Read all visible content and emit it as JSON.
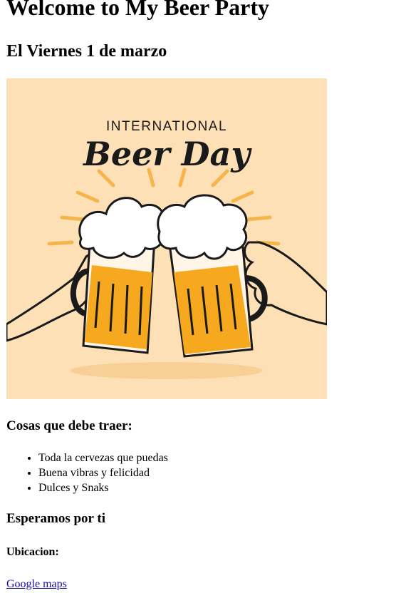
{
  "page": {
    "title": "Welcome to My Beer Party",
    "date": "El Viernes 1 de marzo",
    "poster": {
      "headline": "INTERNATIONAL",
      "brand_script": "Beer Day",
      "colors": {
        "background": "#fde0b6",
        "beer": "#f6a81f",
        "foam": "#ffffff",
        "ink": "#1a1a1a",
        "rays": "#f5b54a"
      }
    },
    "bring_heading": "Cosas que debe traer:",
    "bring_items": [
      "Toda la cervezas que puedas",
      "Buena vibras y felicidad",
      "Dulces y Snaks"
    ],
    "waiting": "Esperamos por ti",
    "location_label": "Ubicacion:",
    "map_link": "Google maps"
  }
}
